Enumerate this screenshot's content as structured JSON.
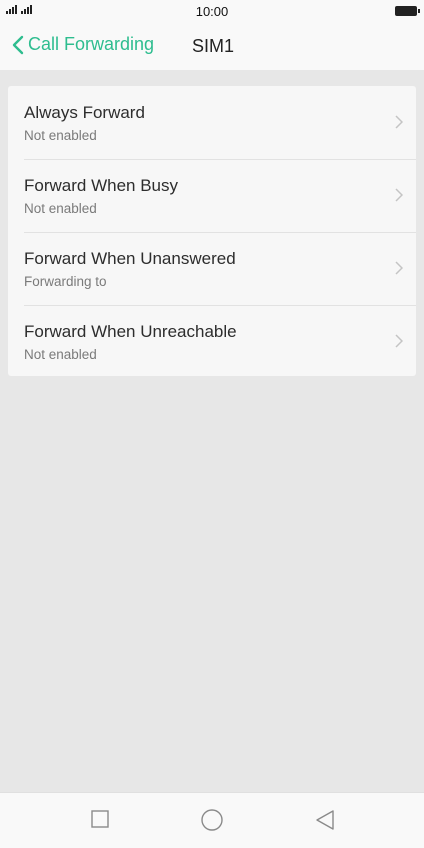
{
  "status": {
    "time": "10:00"
  },
  "header": {
    "back_label": "Call Forwarding",
    "title": "SIM1"
  },
  "forwarding_items": [
    {
      "title": "Always Forward",
      "subtitle": "Not enabled"
    },
    {
      "title": "Forward When Busy",
      "subtitle": "Not enabled"
    },
    {
      "title": "Forward When Unanswered",
      "subtitle": "Forwarding to"
    },
    {
      "title": "Forward When Unreachable",
      "subtitle": "Not enabled"
    }
  ],
  "colors": {
    "accent": "#2ebd8f",
    "background": "#e7e7e7",
    "card": "#f7f7f7"
  },
  "icons": {
    "signal": "signal-icon",
    "battery": "battery-icon",
    "back": "chevron-left-icon",
    "row_arrow": "chevron-right-icon",
    "recents": "square-icon",
    "home": "circle-icon",
    "back_nav": "triangle-back-icon"
  }
}
